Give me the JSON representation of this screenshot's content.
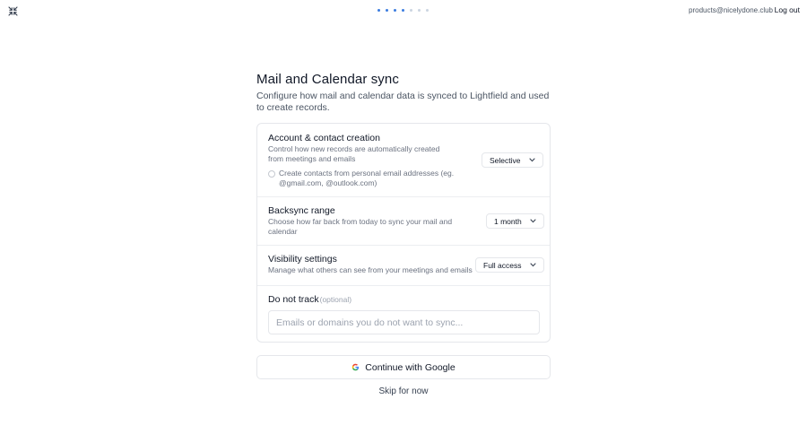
{
  "header": {
    "account_email": "products@nicelydone.club",
    "logout_label": "Log out",
    "progress": {
      "total_steps": 7,
      "completed_steps": 4
    }
  },
  "page": {
    "title": "Mail and Calendar sync",
    "subtitle": "Configure how mail and calendar data is synced to Lightfield and used to create records."
  },
  "sections": {
    "account_contact": {
      "title": "Account & contact creation",
      "description": "Control how new records are automatically created from meetings and emails",
      "select_value": "Selective",
      "checkbox_label": "Create contacts from personal email addresses (eg. @gmail.com, @outlook.com)",
      "checkbox_checked": false
    },
    "backsync": {
      "title": "Backsync range",
      "description": "Choose how far back from today to sync your mail and calendar",
      "select_value": "1 month"
    },
    "visibility": {
      "title": "Visibility settings",
      "description": "Manage what others can see from your meetings and emails",
      "select_value": "Full access"
    },
    "do_not_track": {
      "title": "Do not track",
      "optional_label": "(optional)",
      "placeholder": "Emails or domains you do not want to sync..."
    }
  },
  "actions": {
    "google_label": "Continue with Google",
    "skip_label": "Skip for now"
  },
  "colors": {
    "accent": "#3b7ce0",
    "border": "#e5e7eb",
    "text_primary": "#111827",
    "text_secondary": "#6b7280"
  }
}
